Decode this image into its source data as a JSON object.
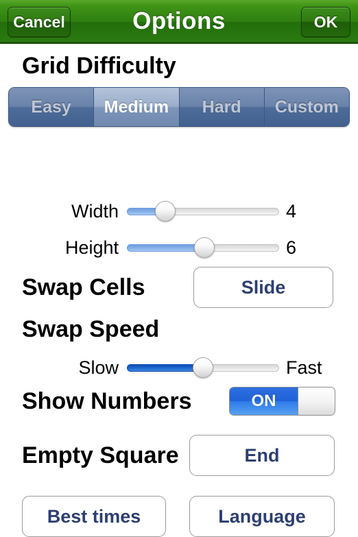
{
  "navbar": {
    "cancel_label": "Cancel",
    "title": "Options",
    "ok_label": "OK",
    "bar_color": "#2e7f10",
    "button_color": "#1d5c08"
  },
  "grid_difficulty": {
    "heading": "Grid Difficulty",
    "options": [
      {
        "label": "Easy",
        "selected": false
      },
      {
        "label": "Medium",
        "selected": true
      },
      {
        "label": "Hard",
        "selected": false
      },
      {
        "label": "Custom",
        "selected": false
      }
    ],
    "selected_value": "Medium"
  },
  "width_slider": {
    "label": "Width",
    "value": "4",
    "percent": 25,
    "fill_color": "#85b0e8"
  },
  "height_slider": {
    "label": "Height",
    "value": "6",
    "percent": 51,
    "fill_color": "#85b0e8"
  },
  "swap_cells": {
    "heading": "Swap Cells",
    "value": "Slide"
  },
  "swap_speed": {
    "heading": "Swap Speed",
    "min_label": "Slow",
    "max_label": "Fast",
    "percent": 50,
    "fill_color": "#1b63cc"
  },
  "show_numbers": {
    "heading": "Show Numbers",
    "state_label": "ON",
    "on_color": "#1f62d8"
  },
  "empty_square": {
    "heading": "Empty Square",
    "value": "End"
  },
  "footer": {
    "best_times_label": "Best times",
    "language_label": "Language",
    "text_color": "#2d3f72"
  }
}
